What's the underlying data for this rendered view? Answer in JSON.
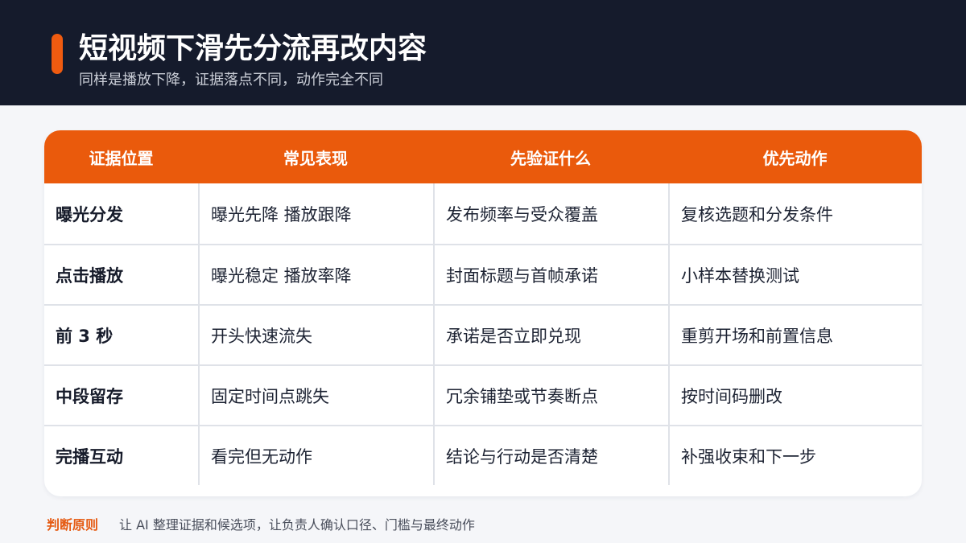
{
  "header": {
    "title": "短视频下滑先分流再改内容",
    "subtitle": "同样是播放下降，证据落点不同，动作完全不同"
  },
  "table": {
    "columns": [
      "证据位置",
      "常见表现",
      "先验证什么",
      "优先动作"
    ],
    "rows": [
      [
        "曝光分发",
        "曝光先降 播放跟降",
        "发布频率与受众覆盖",
        "复核选题和分发条件"
      ],
      [
        "点击播放",
        "曝光稳定 播放率降",
        "封面标题与首帧承诺",
        "小样本替换测试"
      ],
      [
        "前 3 秒",
        "开头快速流失",
        "承诺是否立即兑现",
        "重剪开场和前置信息"
      ],
      [
        "中段留存",
        "固定时间点跳失",
        "冗余铺垫或节奏断点",
        "按时间码删改"
      ],
      [
        "完播互动",
        "看完但无动作",
        "结论与行动是否清楚",
        "补强收束和下一步"
      ]
    ]
  },
  "footer": {
    "label": "判断原则",
    "text": "让 AI 整理证据和候选项，让负责人确认口径、门槛与最终动作"
  },
  "colors": {
    "header_bg": "#151b2c",
    "accent": "#ea5a0c",
    "footer_label": "#e55a12"
  }
}
